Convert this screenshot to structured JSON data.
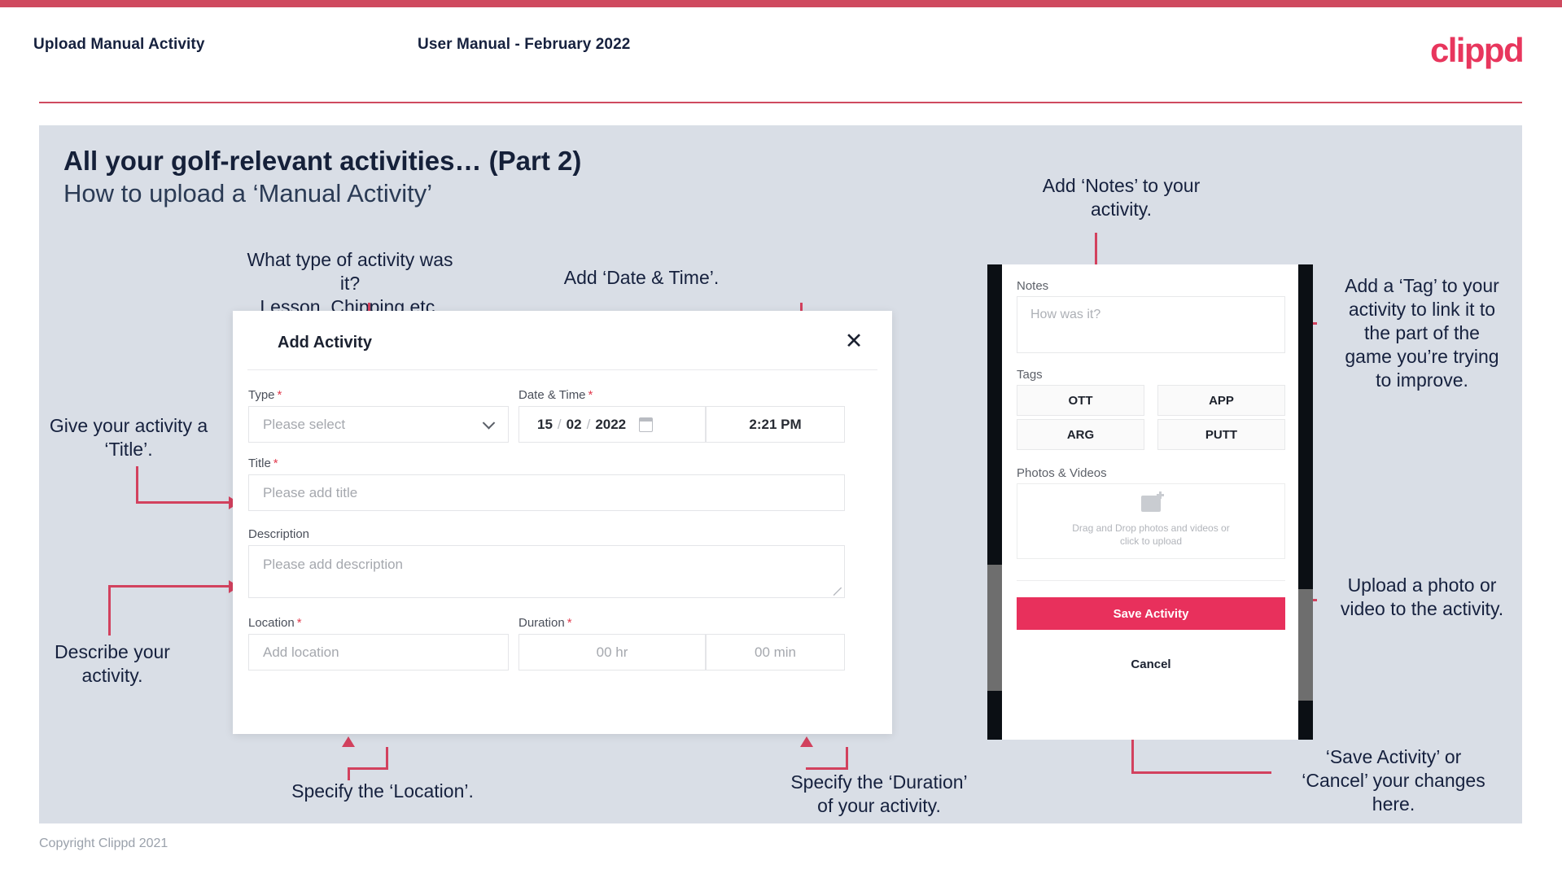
{
  "header": {
    "left_title": "Upload Manual Activity",
    "center_title": "User Manual - February 2022",
    "logo": "clippd"
  },
  "slide": {
    "title_main": "All your golf-relevant activities… (Part 2)",
    "title_sub": "How to upload a ‘Manual Activity’"
  },
  "footer": {
    "copyright": "Copyright Clippd 2021"
  },
  "annotations": {
    "type_note": "What type of activity was it?\nLesson, Chipping etc.",
    "datetime_note": "Add ‘Date & Time’.",
    "title_note": "Give your activity a\n‘Title’.",
    "description_note": "Describe your\nactivity.",
    "location_note": "Specify the ‘Location’.",
    "duration_note": "Specify the ‘Duration’\nof your activity.",
    "notes_note": "Add ‘Notes’ to your\nactivity.",
    "tag_note": "Add a ‘Tag’ to your\nactivity to link it to\nthe part of the\ngame you’re trying\nto improve.",
    "upload_note": "Upload a photo or\nvideo to the activity.",
    "save_note": "‘Save Activity’ or\n‘Cancel’ your changes\nhere."
  },
  "dialog": {
    "title": "Add Activity",
    "close_icon": "✕",
    "fields": {
      "type": {
        "label": "Type",
        "required": "*",
        "placeholder": "Please select"
      },
      "datetime": {
        "label": "Date & Time",
        "required": "*",
        "day": "15",
        "month": "02",
        "year": "2022",
        "separator": "/",
        "time": "2:21 PM"
      },
      "title": {
        "label": "Title",
        "required": "*",
        "placeholder": "Please add title"
      },
      "description": {
        "label": "Description",
        "placeholder": "Please add description"
      },
      "location": {
        "label": "Location",
        "required": "*",
        "placeholder": "Add location"
      },
      "duration": {
        "label": "Duration",
        "required": "*",
        "hours": "00 hr",
        "minutes": "00 min"
      }
    }
  },
  "phone": {
    "notes": {
      "label": "Notes",
      "placeholder": "How was it?"
    },
    "tags": {
      "label": "Tags",
      "items": [
        "OTT",
        "APP",
        "ARG",
        "PUTT"
      ]
    },
    "photos": {
      "label": "Photos & Videos",
      "drop_text_line1": "Drag and Drop photos and videos or",
      "drop_text_line2": "click to upload"
    },
    "save_label": "Save Activity",
    "cancel_label": "Cancel"
  },
  "colors": {
    "accent_pink": "#e8305c",
    "accent_red": "#d2415e",
    "top_bar": "#cf4a5f",
    "slide_bg": "#d9dee6",
    "text_dark": "#16213e"
  }
}
